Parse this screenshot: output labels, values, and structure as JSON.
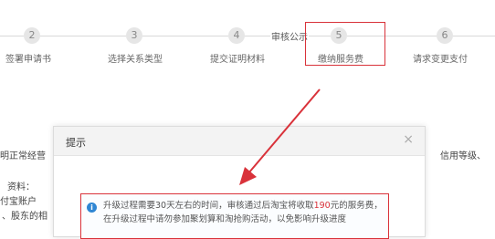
{
  "steps": [
    {
      "num": "2",
      "label": "签署申请书"
    },
    {
      "num": "3",
      "label": "选择关系类型"
    },
    {
      "num": "4",
      "label": "提交证明材料"
    },
    {
      "num": "5",
      "label": "缴纳服务费"
    },
    {
      "num": "6",
      "label": "请求变更支付"
    }
  ],
  "review_label": "审核公示",
  "background": {
    "line1_left": "明正常经营",
    "line1_right": "信用等级、",
    "line2": "资料：",
    "line3": "付宝账户",
    "line4": "、股东的相"
  },
  "modal": {
    "title": "提示",
    "close_symbol": "×",
    "notice": {
      "info_symbol": "i",
      "text_before": "升级过程需要30天左右的时间，审核通过后淘宝将收取",
      "amount": "190",
      "text_after": "元的服务费，在升级过程中请勿参加聚划算和淘抢购活动，以免影响升级进度"
    }
  },
  "colors": {
    "highlight": "#d9323a",
    "info_icon": "#2f86d3"
  }
}
